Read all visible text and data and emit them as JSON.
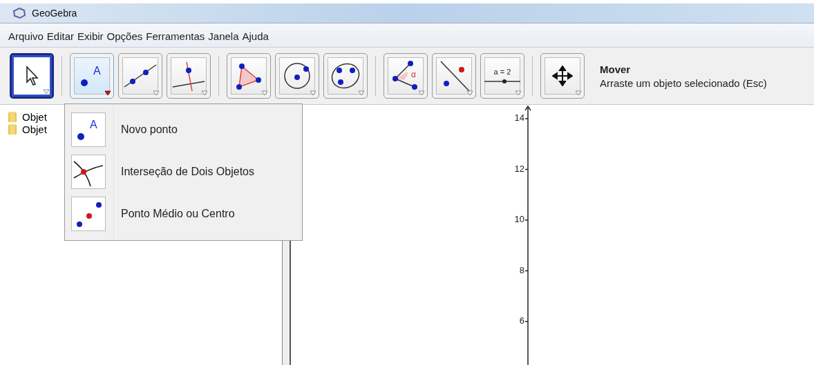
{
  "window": {
    "title": "GeoGebra"
  },
  "menu": [
    "Arquivo",
    "Editar",
    "Exibir",
    "Opções",
    "Ferramentas",
    "Janela",
    "Ajuda"
  ],
  "toolbar": {
    "groups": [
      [
        {
          "kind": "move",
          "selected": true,
          "expanded": false
        }
      ],
      [
        {
          "kind": "point",
          "selected": false,
          "expanded": true,
          "label": "A"
        },
        {
          "kind": "line",
          "selected": false,
          "expanded": false
        },
        {
          "kind": "perpendicular",
          "selected": false,
          "expanded": false
        }
      ],
      [
        {
          "kind": "polygon",
          "selected": false,
          "expanded": false
        },
        {
          "kind": "circle",
          "selected": false,
          "expanded": false
        },
        {
          "kind": "conic",
          "selected": false,
          "expanded": false
        }
      ],
      [
        {
          "kind": "angle",
          "selected": false,
          "expanded": false,
          "label": "α"
        },
        {
          "kind": "reflect",
          "selected": false,
          "expanded": false
        },
        {
          "kind": "slider",
          "selected": false,
          "expanded": false,
          "label": "a = 2"
        }
      ],
      [
        {
          "kind": "move-view",
          "selected": false,
          "expanded": false
        }
      ]
    ],
    "tool_title": "Mover",
    "tool_help": "Arraste um objeto selecionado (Esc)"
  },
  "algebra_view": {
    "items": [
      {
        "label": "Objet"
      },
      {
        "label": "Objet"
      }
    ]
  },
  "dropdown": {
    "items": [
      {
        "kind": "point",
        "label": "Novo ponto",
        "icon_label": "A"
      },
      {
        "kind": "intersect",
        "label": "Interseção de Dois Objetos"
      },
      {
        "kind": "midpoint",
        "label": "Ponto Médio ou Centro"
      }
    ]
  },
  "graphics": {
    "y_ticks": [
      "14",
      "12",
      "10",
      "8",
      "6"
    ]
  }
}
